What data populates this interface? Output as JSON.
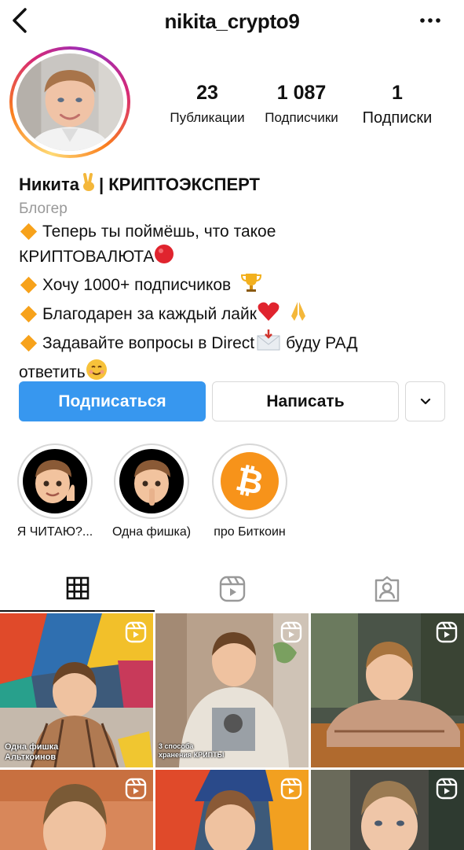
{
  "header": {
    "username": "nikita_crypto9"
  },
  "stats": [
    {
      "count": "23",
      "label": "Публикации"
    },
    {
      "count": "1 087",
      "label": "Подписчики"
    },
    {
      "count": "1",
      "label": "Подписки"
    }
  ],
  "bio": {
    "name": "Никита",
    "name_suffix": "| КРИПТОЭКСПЕРТ",
    "category": "Блогер",
    "line1": "Теперь ты поймёшь, что такое",
    "line2": "КРИПТОВАЛЮТА",
    "line3": "Хочу 1000+ подписчиков",
    "line4": "Благодарен за каждый лайк",
    "line5_a": "Задавайте вопросы в Direct",
    "line5_b": "буду РАД",
    "line6": "ответить"
  },
  "actions": {
    "follow_label": "Подписаться",
    "message_label": "Написать"
  },
  "highlights": [
    {
      "label": "Я ЧИТАЮ?..."
    },
    {
      "label": "Одна фишка)"
    },
    {
      "label": "про Биткоин"
    }
  ],
  "tabs": [
    {
      "icon": "grid-icon"
    },
    {
      "icon": "reels-icon"
    },
    {
      "icon": "tagged-icon"
    }
  ],
  "posts": [
    {
      "caption_1": "Одна фишка",
      "caption_2": "Альткоинов"
    },
    {
      "caption_1": "3 способа",
      "caption_2": "хранения КРИПТЫ"
    },
    {
      "caption_1": "",
      "caption_2": ""
    },
    {
      "caption_1": "",
      "caption_2": ""
    },
    {
      "caption_1": "",
      "caption_2": ""
    },
    {
      "caption_1": "",
      "caption_2": ""
    }
  ],
  "colors": {
    "accent": "#3797ef",
    "bitcoin": "#f7931a",
    "diamond": "#f7a21b"
  }
}
